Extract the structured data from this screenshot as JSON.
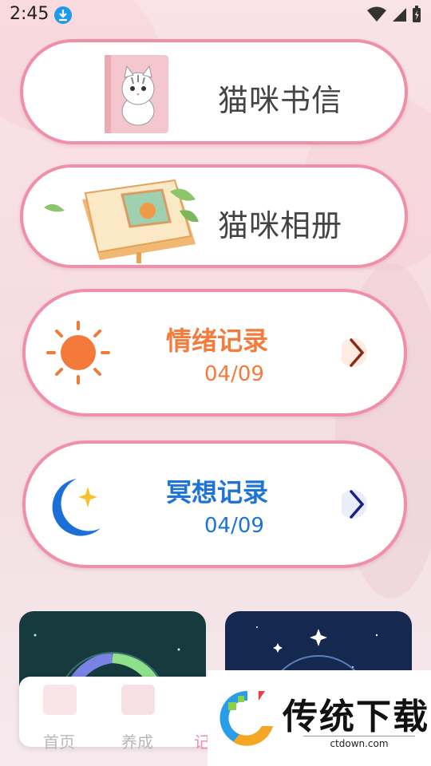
{
  "status": {
    "time": "2:45"
  },
  "cards": {
    "letters": {
      "title": "猫咪书信"
    },
    "album": {
      "title": "猫咪相册"
    },
    "emotion": {
      "title": "情绪记录",
      "date": "04/09",
      "accent": "#f47b3c"
    },
    "meditation": {
      "title": "冥想记录",
      "date": "04/09",
      "accent": "#1d73d6"
    }
  },
  "nav": {
    "items": [
      {
        "label": "首页"
      },
      {
        "label": "养成"
      },
      {
        "label": "记"
      }
    ]
  },
  "watermark": {
    "brand": "传统下载",
    "site": "ctdown.com"
  },
  "icons": {
    "download": "download-icon",
    "wifi": "wifi-icon",
    "signal": "signal-icon",
    "battery": "battery-icon",
    "sun": "sun-icon",
    "moon": "moon-icon",
    "chevron": "chevron-right-icon"
  }
}
